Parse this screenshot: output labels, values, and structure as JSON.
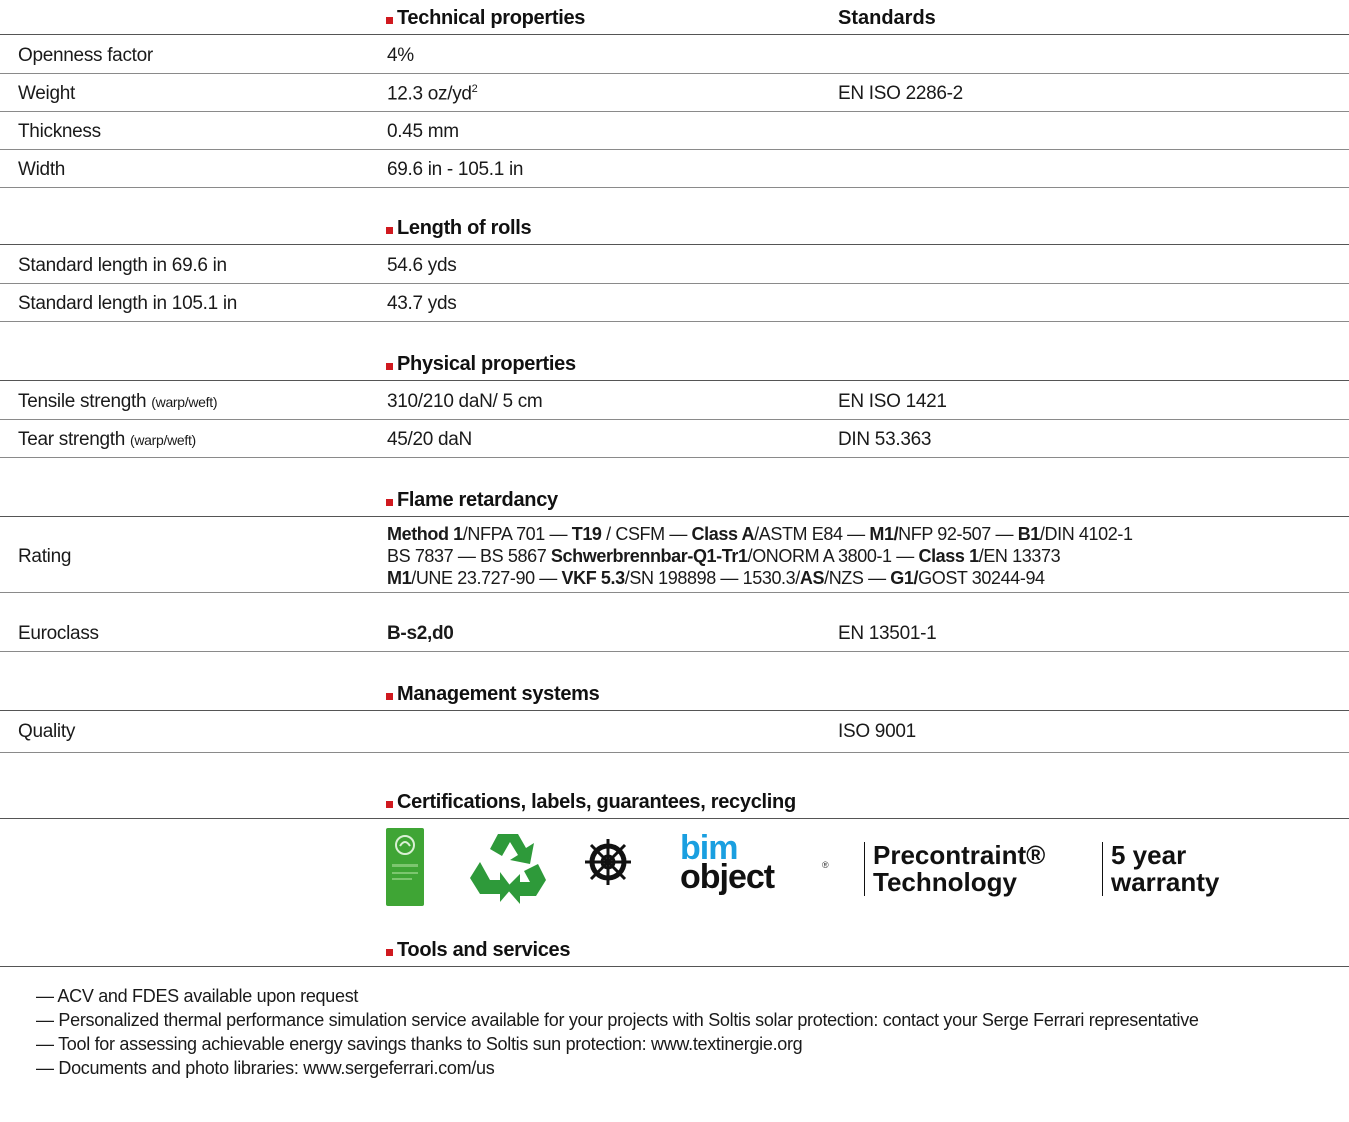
{
  "technical": {
    "heading": "Technical properties",
    "standards_heading": "Standards",
    "rows": [
      {
        "label": "Openness factor",
        "value": "4%",
        "standard": ""
      },
      {
        "label": "Weight",
        "value": "12.3 oz/yd",
        "value_sup": "2",
        "standard": "EN ISO 2286-2"
      },
      {
        "label": "Thickness",
        "value": "0.45 mm",
        "standard": ""
      },
      {
        "label": "Width",
        "value": "69.6 in - 105.1 in",
        "standard": ""
      }
    ]
  },
  "rolls": {
    "heading": "Length of rolls",
    "rows": [
      {
        "label": "Standard length in 69.6 in",
        "value": "54.6 yds"
      },
      {
        "label": "Standard length in 105.1 in",
        "value": "43.7 yds"
      }
    ]
  },
  "physical": {
    "heading": "Physical properties",
    "rows": [
      {
        "label": "Tensile strength",
        "note": "(warp/weft)",
        "value": "310/210 daN/ 5 cm",
        "standard": "EN ISO 1421"
      },
      {
        "label": "Tear strength",
        "note": "(warp/weft)",
        "value": "45/20 daN",
        "standard": "DIN 53.363"
      }
    ]
  },
  "flame": {
    "heading": "Flame retardancy",
    "rating_label": "Rating",
    "rating_line1": [
      {
        "b": "Method 1"
      },
      {
        "t": "/NFPA 701 — "
      },
      {
        "b": "T19"
      },
      {
        "t": " / CSFM — "
      },
      {
        "b": "Class A"
      },
      {
        "t": "/ASTM E84  — "
      },
      {
        "b": "M1/"
      },
      {
        "t": "NFP 92-507 — "
      },
      {
        "b": "B1"
      },
      {
        "t": "/DIN 4102-1"
      }
    ],
    "rating_line2": [
      {
        "t": "BS 7837 — BS 5867  "
      },
      {
        "b": "Schwerbrennbar-Q1-Tr1"
      },
      {
        "t": "/ONORM A 3800-1 — "
      },
      {
        "b": "Class 1"
      },
      {
        "t": "/EN 13373"
      }
    ],
    "rating_line3": [
      {
        "b": "M1"
      },
      {
        "t": "/UNE 23.727-90 — "
      },
      {
        "b": "VKF 5.3"
      },
      {
        "t": "/SN 198898 — 1530.3/"
      },
      {
        "b": "AS"
      },
      {
        "t": "/NZS — "
      },
      {
        "b": "G1/"
      },
      {
        "t": "GOST 30244-94"
      }
    ],
    "euroclass_label": "Euroclass",
    "euroclass_value": "B-s2,d0",
    "euroclass_standard": "EN 13501-1"
  },
  "management": {
    "heading": "Management systems",
    "quality_label": "Quality",
    "quality_standard": "ISO 9001"
  },
  "certifications": {
    "heading": "Certifications, labels, guarantees, recycling",
    "logos": [
      {
        "icon": "green-label-icon"
      },
      {
        "icon": "recycling-icon"
      },
      {
        "icon": "ship-wheel-icon"
      },
      {
        "icon": "bim-object-logo",
        "text_top": "bim",
        "text_bottom": "object"
      },
      {
        "icon": "precontraint-logo",
        "line1": "Precontraint®",
        "line2": "Technology"
      },
      {
        "icon": "warranty-logo",
        "line1": "5 year",
        "line2": "warranty"
      }
    ],
    "colors": {
      "green": "#3fa535",
      "dark_green": "#2e8b2e",
      "bim_blue": "#1a9fe0"
    }
  },
  "tools": {
    "heading": "Tools and services",
    "items": [
      "— ACV and FDES available upon request",
      "— Personalized thermal performance simulation service available for your projects with Soltis solar protection: contact your Serge Ferrari representative",
      "— Tool for assessing achievable energy savings thanks to Soltis sun protection: www.textinergie.org",
      "— Documents and photo libraries: www.sergeferrari.com/us"
    ]
  },
  "accent_color": "#d0191f"
}
